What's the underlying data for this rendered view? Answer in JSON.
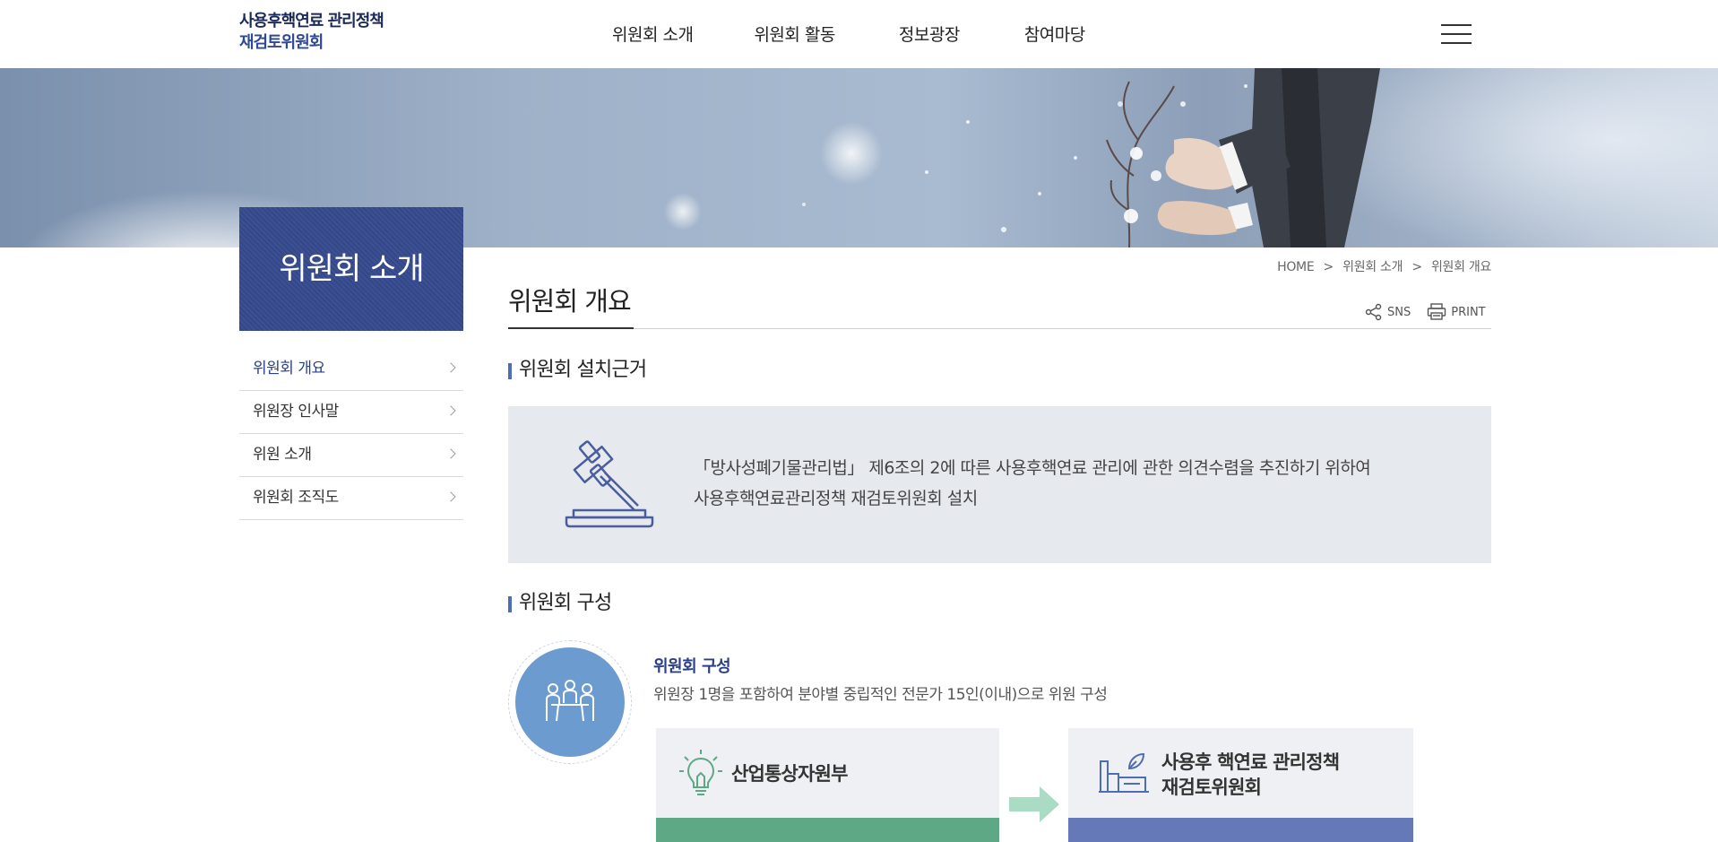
{
  "header": {
    "logo_line1": "사용후핵연료 관리정책",
    "logo_line2": "재검토위원회",
    "nav": [
      "위원회 소개",
      "위원회 활동",
      "정보광장",
      "참여마당"
    ],
    "menu_icon": "hamburger-icon"
  },
  "sidebar": {
    "title": "위원회 소개",
    "items": [
      {
        "label": "위원회 개요",
        "active": true
      },
      {
        "label": "위원장 인사말",
        "active": false
      },
      {
        "label": "위원 소개",
        "active": false
      },
      {
        "label": "위원회 조직도",
        "active": false
      }
    ]
  },
  "breadcrumb": {
    "home": "HOME",
    "separator": ">",
    "level1": "위원회 소개",
    "level2": "위원회 개요"
  },
  "page": {
    "title": "위원회 개요",
    "tools": {
      "sns": "SNS",
      "print": "PRINT"
    }
  },
  "section1": {
    "title": "위원회 설치근거",
    "line1": "「방사성폐기물관리법」 제6조의 2에 따른 사용후핵연료 관리에 관한 의견수렴을 추진하기 위하여",
    "line2": "사용후핵연료관리정책 재검토위원회 설치"
  },
  "section2": {
    "title": "위원회 구성",
    "sub_title": "위원회 구성",
    "sub_desc": "위원장 1명을 포함하여 분야별 중립적인 전문가 15인(이내)으로 위원 구성",
    "left_box": "산업통상자원부",
    "right_box_line1": "사용후 핵연료 관리정책",
    "right_box_line2": "재검토위원회"
  },
  "colors": {
    "primary": "#33478a",
    "accent_blue": "#6c9bd0",
    "green": "#5ea885",
    "purple_blue": "#6579b8",
    "box_gray": "#e6e9ee"
  }
}
